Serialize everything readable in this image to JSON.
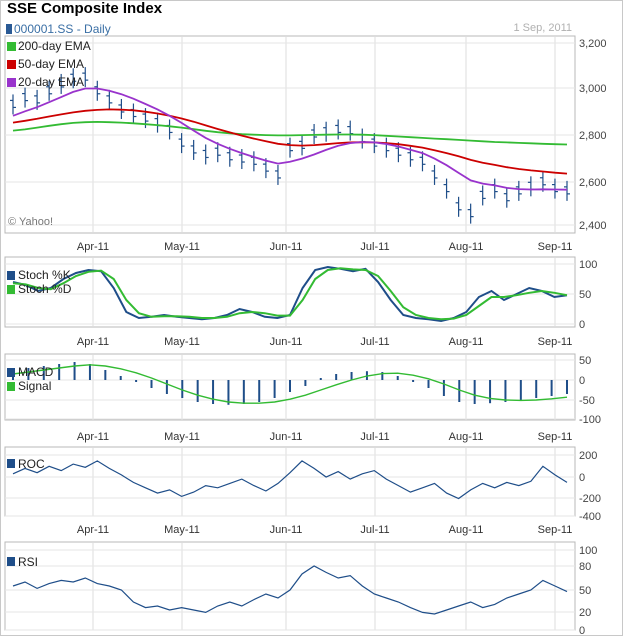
{
  "header": {
    "title": "SSE Composite Index",
    "symbol": "000001.SS - Daily",
    "date": "1 Sep, 2011"
  },
  "colors": {
    "price": "#1f4e89",
    "ema200": "#33bb33",
    "ema50": "#cc0000",
    "ema20": "#9933cc",
    "stochK": "#1f4e89",
    "stochD": "#33bb33",
    "macd": "#1f4e89",
    "signal": "#33bb33",
    "roc": "#1f4e89",
    "rsi": "#1f4e89"
  },
  "chart_data": [
    {
      "type": "line",
      "title": "SSE Composite Index",
      "x": [
        "Apr-11",
        "May-11",
        "Jun-11",
        "Jul-11",
        "Aug-11",
        "Sep-11"
      ],
      "ylim": [
        2400,
        3200
      ],
      "yticks": [
        "3,200",
        "3,000",
        "2,800",
        "2,600",
        "2,400"
      ],
      "legend": [
        "200-day EMA",
        "50-day EMA",
        "20-day EMA"
      ],
      "watermark": "© Yahoo!",
      "series": [
        {
          "name": "Price",
          "values": [
            2930,
            2960,
            2950,
            2990,
            3020,
            3045,
            3050,
            2990,
            2950,
            2910,
            2890,
            2870,
            2850,
            2820,
            2760,
            2730,
            2710,
            2720,
            2700,
            2690,
            2680,
            2650,
            2620,
            2740,
            2750,
            2800,
            2810,
            2820,
            2815,
            2780,
            2760,
            2740,
            2720,
            2700,
            2680,
            2620,
            2560,
            2480,
            2450,
            2530,
            2560,
            2520,
            2550,
            2570,
            2590,
            2560,
            2550
          ]
        },
        {
          "name": "200-day EMA",
          "values": [
            2815,
            2820,
            2828,
            2836,
            2843,
            2849,
            2852,
            2853,
            2852,
            2850,
            2847,
            2843,
            2839,
            2834,
            2828,
            2821,
            2814,
            2808,
            2803,
            2799,
            2797,
            2795,
            2794,
            2794,
            2795,
            2796,
            2797,
            2798,
            2798,
            2797,
            2795,
            2792,
            2789,
            2786,
            2783,
            2780,
            2777,
            2774,
            2771,
            2768,
            2765,
            2763,
            2761,
            2759,
            2757,
            2755,
            2754
          ]
        },
        {
          "name": "50-day EMA",
          "values": [
            2850,
            2858,
            2867,
            2877,
            2886,
            2895,
            2902,
            2906,
            2908,
            2907,
            2904,
            2898,
            2890,
            2880,
            2868,
            2854,
            2838,
            2822,
            2807,
            2793,
            2780,
            2768,
            2757,
            2751,
            2749,
            2751,
            2755,
            2760,
            2763,
            2764,
            2763,
            2760,
            2755,
            2748,
            2740,
            2729,
            2716,
            2702,
            2686,
            2674,
            2664,
            2654,
            2646,
            2640,
            2635,
            2630,
            2626
          ]
        },
        {
          "name": "20-day EMA",
          "values": [
            2880,
            2900,
            2918,
            2940,
            2962,
            2985,
            3000,
            3000,
            2990,
            2975,
            2955,
            2932,
            2908,
            2880,
            2849,
            2815,
            2783,
            2757,
            2735,
            2716,
            2699,
            2683,
            2670,
            2678,
            2692,
            2710,
            2730,
            2748,
            2760,
            2765,
            2763,
            2756,
            2745,
            2731,
            2716,
            2692,
            2663,
            2629,
            2596,
            2582,
            2574,
            2563,
            2558,
            2556,
            2557,
            2556,
            2555
          ]
        }
      ]
    },
    {
      "type": "line",
      "legend": [
        "Stoch %K",
        "Stoch %D"
      ],
      "ylim": [
        0,
        100
      ],
      "yticks": [
        "100",
        "50",
        "0"
      ],
      "x": [
        "Apr-11",
        "May-11",
        "Jun-11",
        "Jul-11",
        "Aug-11",
        "Sep-11"
      ],
      "series": [
        {
          "name": "Stoch %K",
          "values": [
            70,
            65,
            55,
            60,
            75,
            85,
            90,
            88,
            60,
            20,
            10,
            12,
            15,
            12,
            10,
            8,
            10,
            15,
            25,
            20,
            12,
            10,
            15,
            60,
            90,
            95,
            92,
            88,
            92,
            70,
            40,
            15,
            10,
            8,
            5,
            10,
            20,
            45,
            55,
            40,
            50,
            60,
            55,
            45,
            48
          ]
        },
        {
          "name": "Stoch %D",
          "values": [
            68,
            66,
            60,
            58,
            68,
            80,
            87,
            89,
            75,
            40,
            18,
            12,
            13,
            13,
            12,
            10,
            10,
            12,
            18,
            20,
            18,
            14,
            14,
            40,
            75,
            90,
            93,
            91,
            90,
            80,
            55,
            28,
            15,
            10,
            8,
            9,
            15,
            30,
            45,
            45,
            48,
            52,
            55,
            52,
            48
          ]
        }
      ]
    },
    {
      "type": "bar",
      "legend": [
        "MACD",
        "Signal"
      ],
      "ylim": [
        -100,
        50
      ],
      "yticks": [
        "50",
        "0",
        "-50",
        "-100"
      ],
      "x": [
        "Apr-11",
        "May-11",
        "Jun-11",
        "Jul-11",
        "Aug-11",
        "Sep-11"
      ],
      "series": [
        {
          "name": "MACD",
          "values": [
            20,
            30,
            35,
            40,
            45,
            40,
            25,
            10,
            -5,
            -20,
            -35,
            -45,
            -55,
            -60,
            -62,
            -60,
            -55,
            -45,
            -30,
            -15,
            5,
            15,
            20,
            22,
            20,
            10,
            -5,
            -20,
            -40,
            -55,
            -60,
            -58,
            -55,
            -50,
            -45,
            -40,
            -35
          ]
        },
        {
          "name": "Signal",
          "values": [
            15,
            20,
            25,
            30,
            35,
            38,
            35,
            28,
            18,
            5,
            -10,
            -25,
            -38,
            -48,
            -55,
            -58,
            -58,
            -55,
            -48,
            -38,
            -25,
            -12,
            0,
            10,
            16,
            17,
            12,
            3,
            -10,
            -25,
            -38,
            -46,
            -50,
            -51,
            -50,
            -47,
            -43
          ]
        }
      ]
    },
    {
      "type": "line",
      "legend": [
        "ROC"
      ],
      "ylim": [
        -400,
        200
      ],
      "yticks": [
        "200",
        "0",
        "-200",
        "-400"
      ],
      "x": [
        "Apr-11",
        "May-11",
        "Jun-11",
        "Jul-11",
        "Aug-11",
        "Sep-11"
      ],
      "series": [
        {
          "name": "ROC",
          "values": [
            30,
            80,
            40,
            100,
            60,
            120,
            90,
            150,
            80,
            20,
            -50,
            -100,
            -150,
            -120,
            -180,
            -140,
            -80,
            -100,
            -60,
            -20,
            -80,
            -130,
            -60,
            40,
            150,
            80,
            0,
            50,
            -20,
            30,
            60,
            -20,
            -80,
            -140,
            -100,
            -60,
            -150,
            -200,
            -120,
            -60,
            -100,
            -50,
            -80,
            -40,
            100,
            20,
            -50
          ]
        }
      ]
    },
    {
      "type": "line",
      "legend": [
        "RSI"
      ],
      "ylim": [
        0,
        100
      ],
      "yticks": [
        "100",
        "80",
        "50",
        "20",
        "0"
      ],
      "x": [
        "Apr-11",
        "May-11",
        "Jun-11",
        "Jul-11",
        "Aug-11",
        "Sep-11"
      ],
      "series": [
        {
          "name": "RSI",
          "values": [
            55,
            60,
            52,
            58,
            62,
            60,
            65,
            58,
            55,
            50,
            35,
            28,
            30,
            25,
            28,
            25,
            22,
            30,
            35,
            30,
            38,
            45,
            40,
            50,
            70,
            80,
            72,
            65,
            68,
            55,
            45,
            40,
            35,
            28,
            22,
            20,
            25,
            30,
            35,
            28,
            32,
            40,
            45,
            50,
            62,
            55,
            48
          ]
        }
      ]
    }
  ]
}
